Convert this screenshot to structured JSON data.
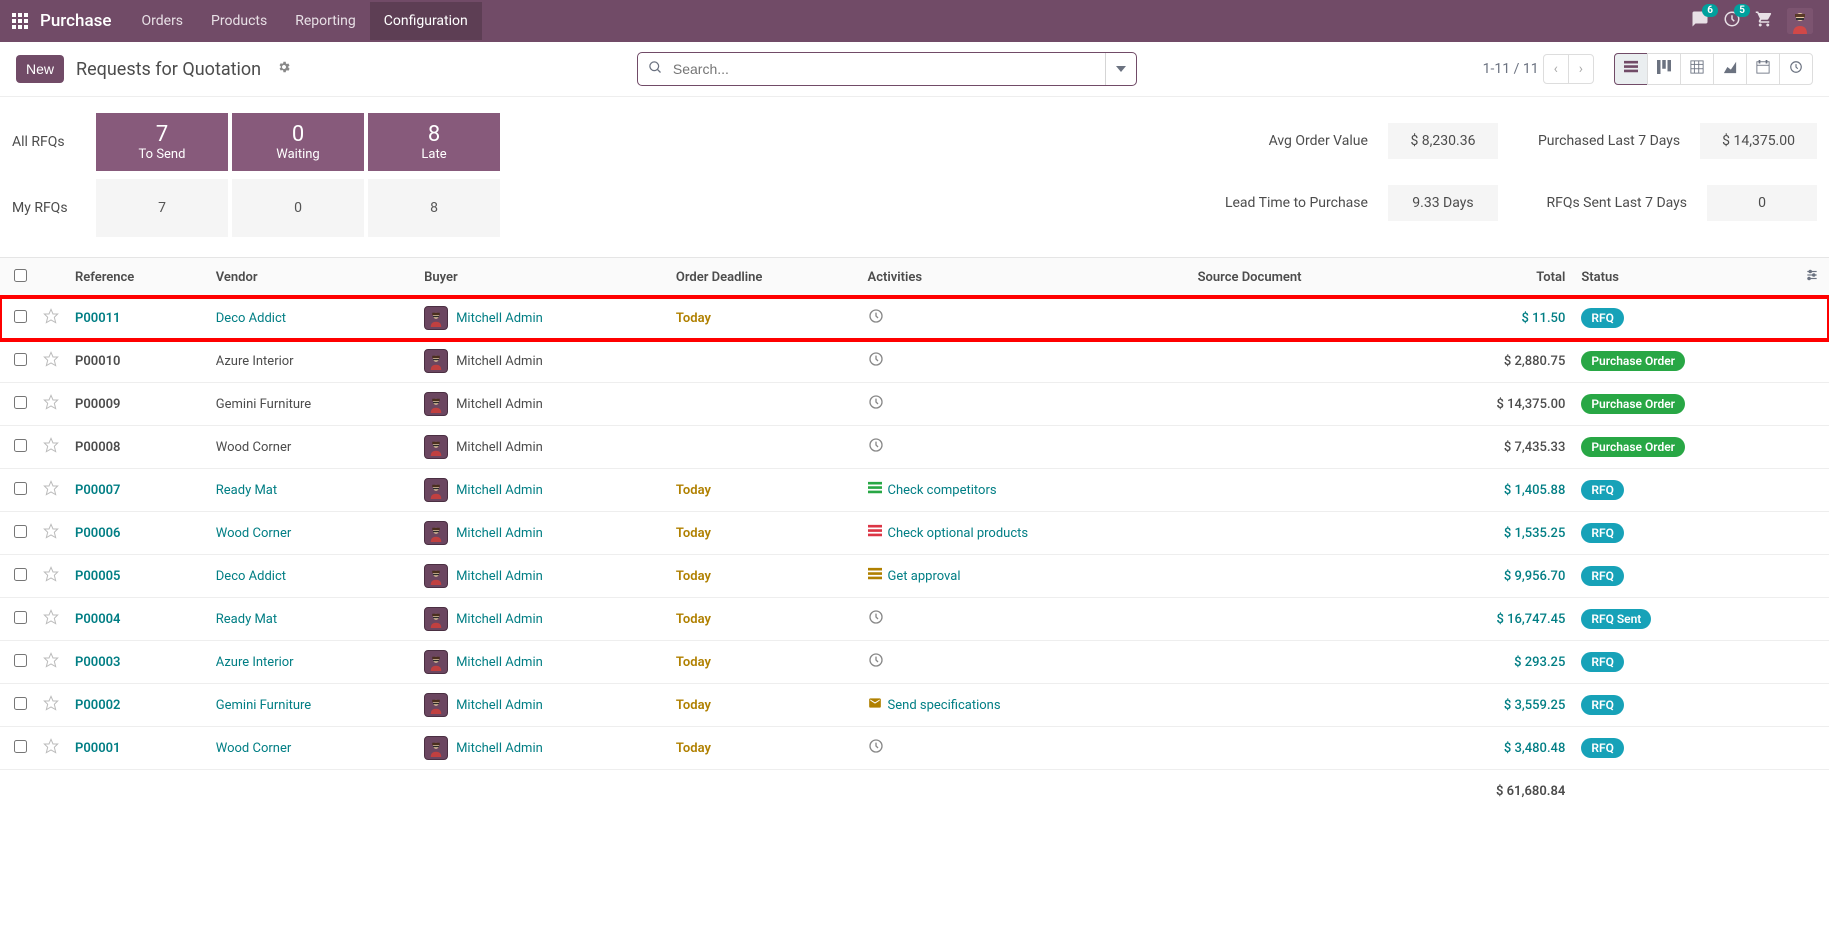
{
  "navbar": {
    "app_title": "Purchase",
    "menu": [
      "Orders",
      "Products",
      "Reporting",
      "Configuration"
    ],
    "active_index": 3,
    "msg_badge": "6",
    "act_badge": "5"
  },
  "control": {
    "new_label": "New",
    "page_title": "Requests for Quotation",
    "search_placeholder": "Search...",
    "pager": "1-11 / 11"
  },
  "dashboard": {
    "all_label": "All RFQs",
    "my_label": "My RFQs",
    "cards": [
      {
        "num": "7",
        "sub": "To Send"
      },
      {
        "num": "0",
        "sub": "Waiting"
      },
      {
        "num": "8",
        "sub": "Late"
      }
    ],
    "my_cards": [
      "7",
      "0",
      "8"
    ],
    "stats": [
      {
        "label": "Avg Order Value",
        "value": "$ 8,230.36"
      },
      {
        "label": "Lead Time to Purchase",
        "value": "9.33 Days"
      },
      {
        "label": "Purchased Last 7 Days",
        "value": "$ 14,375.00"
      },
      {
        "label": "RFQs Sent Last 7 Days",
        "value": "0"
      }
    ]
  },
  "table": {
    "headers": {
      "reference": "Reference",
      "vendor": "Vendor",
      "buyer": "Buyer",
      "deadline": "Order Deadline",
      "activities": "Activities",
      "source": "Source Document",
      "total": "Total",
      "status": "Status"
    },
    "rows": [
      {
        "ref": "P00011",
        "ref_link": true,
        "vendor": "Deco Addict",
        "vendor_link": true,
        "buyer": "Mitchell Admin",
        "buyer_link": true,
        "deadline": "Today",
        "activity_type": "clock",
        "activity_text": "",
        "total": "$ 11.50",
        "total_link": true,
        "status": "RFQ",
        "status_class": "status-rfq",
        "highlight": true
      },
      {
        "ref": "P00010",
        "ref_link": false,
        "vendor": "Azure Interior",
        "vendor_link": false,
        "buyer": "Mitchell Admin",
        "buyer_link": false,
        "deadline": "",
        "activity_type": "clock",
        "activity_text": "",
        "total": "$ 2,880.75",
        "total_link": false,
        "status": "Purchase Order",
        "status_class": "status-po"
      },
      {
        "ref": "P00009",
        "ref_link": false,
        "vendor": "Gemini Furniture",
        "vendor_link": false,
        "buyer": "Mitchell Admin",
        "buyer_link": false,
        "deadline": "",
        "activity_type": "clock",
        "activity_text": "",
        "total": "$ 14,375.00",
        "total_link": false,
        "status": "Purchase Order",
        "status_class": "status-po"
      },
      {
        "ref": "P00008",
        "ref_link": false,
        "vendor": "Wood Corner",
        "vendor_link": false,
        "buyer": "Mitchell Admin",
        "buyer_link": false,
        "deadline": "",
        "activity_type": "clock",
        "activity_text": "",
        "total": "$ 7,435.33",
        "total_link": false,
        "status": "Purchase Order",
        "status_class": "status-po"
      },
      {
        "ref": "P00007",
        "ref_link": true,
        "vendor": "Ready Mat",
        "vendor_link": true,
        "buyer": "Mitchell Admin",
        "buyer_link": true,
        "deadline": "Today",
        "activity_type": "task",
        "activity_color": "#28a745",
        "activity_text": "Check competitors",
        "total": "$ 1,405.88",
        "total_link": true,
        "status": "RFQ",
        "status_class": "status-rfq"
      },
      {
        "ref": "P00006",
        "ref_link": true,
        "vendor": "Wood Corner",
        "vendor_link": true,
        "buyer": "Mitchell Admin",
        "buyer_link": true,
        "deadline": "Today",
        "activity_type": "task",
        "activity_color": "#dc3545",
        "activity_text": "Check optional products",
        "total": "$ 1,535.25",
        "total_link": true,
        "status": "RFQ",
        "status_class": "status-rfq"
      },
      {
        "ref": "P00005",
        "ref_link": true,
        "vendor": "Deco Addict",
        "vendor_link": true,
        "buyer": "Mitchell Admin",
        "buyer_link": true,
        "deadline": "Today",
        "activity_type": "task",
        "activity_color": "#b08000",
        "activity_text": "Get approval",
        "total": "$ 9,956.70",
        "total_link": true,
        "status": "RFQ",
        "status_class": "status-rfq"
      },
      {
        "ref": "P00004",
        "ref_link": true,
        "vendor": "Ready Mat",
        "vendor_link": true,
        "buyer": "Mitchell Admin",
        "buyer_link": true,
        "deadline": "Today",
        "activity_type": "clock",
        "activity_text": "",
        "total": "$ 16,747.45",
        "total_link": true,
        "status": "RFQ Sent",
        "status_class": "status-sent"
      },
      {
        "ref": "P00003",
        "ref_link": true,
        "vendor": "Azure Interior",
        "vendor_link": true,
        "buyer": "Mitchell Admin",
        "buyer_link": true,
        "deadline": "Today",
        "activity_type": "clock",
        "activity_text": "",
        "total": "$ 293.25",
        "total_link": true,
        "status": "RFQ",
        "status_class": "status-rfq"
      },
      {
        "ref": "P00002",
        "ref_link": true,
        "vendor": "Gemini Furniture",
        "vendor_link": true,
        "buyer": "Mitchell Admin",
        "buyer_link": true,
        "deadline": "Today",
        "activity_type": "mail",
        "activity_color": "#b08000",
        "activity_text": "Send specifications",
        "total": "$ 3,559.25",
        "total_link": true,
        "status": "RFQ",
        "status_class": "status-rfq"
      },
      {
        "ref": "P00001",
        "ref_link": true,
        "vendor": "Wood Corner",
        "vendor_link": true,
        "buyer": "Mitchell Admin",
        "buyer_link": true,
        "deadline": "Today",
        "activity_type": "clock",
        "activity_text": "",
        "total": "$ 3,480.48",
        "total_link": true,
        "status": "RFQ",
        "status_class": "status-rfq"
      }
    ],
    "grand_total": "$ 61,680.84"
  }
}
